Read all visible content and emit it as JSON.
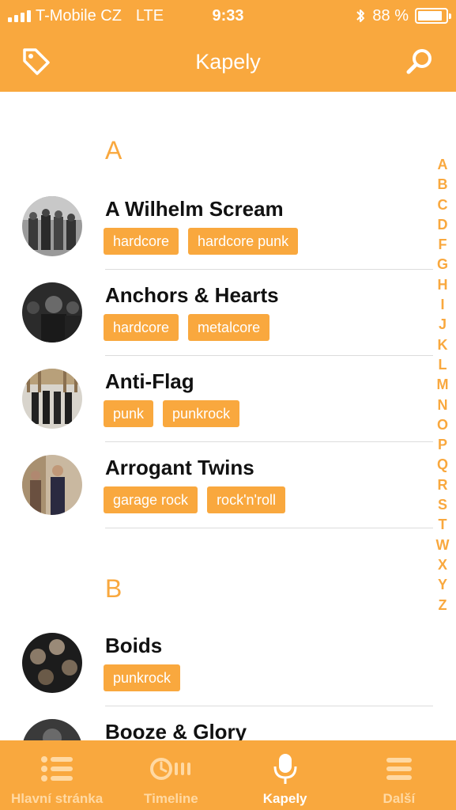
{
  "status_bar": {
    "carrier": "T-Mobile CZ",
    "network": "LTE",
    "time": "9:33",
    "battery_percent": "88 %",
    "battery_level": 0.88
  },
  "nav": {
    "title": "Kapely",
    "left_icon": "tag-icon",
    "right_icon": "search-icon"
  },
  "sections": [
    {
      "letter": "A",
      "bands": [
        {
          "name": "A Wilhelm Scream",
          "tags": [
            "hardcore",
            "hardcore punk"
          ]
        },
        {
          "name": "Anchors & Hearts",
          "tags": [
            "hardcore",
            "metalcore"
          ]
        },
        {
          "name": "Anti-Flag",
          "tags": [
            "punk",
            "punkrock"
          ]
        },
        {
          "name": "Arrogant Twins",
          "tags": [
            "garage rock",
            "rock'n'roll"
          ]
        }
      ]
    },
    {
      "letter": "B",
      "bands": [
        {
          "name": "Boids",
          "tags": [
            "punkrock"
          ]
        },
        {
          "name": "Booze & Glory",
          "tags": []
        }
      ]
    }
  ],
  "alphabet_index": [
    "A",
    "B",
    "C",
    "D",
    "F",
    "G",
    "H",
    "I",
    "J",
    "K",
    "L",
    "M",
    "N",
    "O",
    "P",
    "Q",
    "R",
    "S",
    "T",
    "W",
    "X",
    "Y",
    "Z"
  ],
  "tab_bar": {
    "tabs": [
      {
        "label": "Hlavní stránka",
        "icon": "list-icon",
        "active": false
      },
      {
        "label": "Timeline",
        "icon": "clock-icon",
        "active": false
      },
      {
        "label": "Kapely",
        "icon": "microphone-icon",
        "active": true
      },
      {
        "label": "Další",
        "icon": "menu-icon",
        "active": false
      }
    ]
  },
  "colors": {
    "accent": "#f9a83e",
    "tab_inactive": "#ffd9a3",
    "text": "#111111",
    "separator": "#dcdcdc"
  }
}
